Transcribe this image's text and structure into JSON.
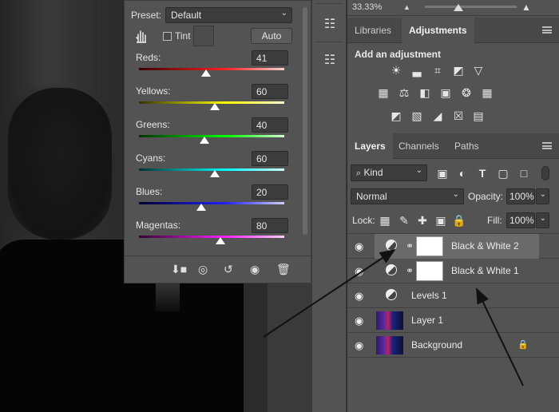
{
  "properties": {
    "preset_label": "Preset:",
    "preset_value": "Default",
    "tint_label": "Tint",
    "auto_label": "Auto",
    "sliders": [
      {
        "label": "Reds:",
        "value": "41"
      },
      {
        "label": "Yellows:",
        "value": "60"
      },
      {
        "label": "Greens:",
        "value": "40"
      },
      {
        "label": "Cyans:",
        "value": "60"
      },
      {
        "label": "Blues:",
        "value": "20"
      },
      {
        "label": "Magentas:",
        "value": "80"
      }
    ],
    "slider_fractions": [
      0.46,
      0.52,
      0.45,
      0.52,
      0.43,
      0.56
    ]
  },
  "top_bar": {
    "zoom": "33.33%"
  },
  "adjustments_panel": {
    "tabs": [
      "Libraries",
      "Adjustments"
    ],
    "active_tab": "Adjustments",
    "heading": "Add an adjustment",
    "icons_row1": [
      "brightness-icon",
      "levels-icon",
      "curves-icon",
      "exposure-icon",
      "vibrance-icon"
    ],
    "icons_row2": [
      "hue-saturation-icon",
      "color-balance-icon",
      "black-white-icon",
      "photo-filter-icon",
      "channel-mixer-icon",
      "color-lookup-icon"
    ],
    "icons_row3": [
      "invert-icon",
      "posterize-icon",
      "threshold-icon",
      "selective-color-icon",
      "gradient-map-icon"
    ]
  },
  "layers_panel": {
    "tabs": [
      "Layers",
      "Channels",
      "Paths"
    ],
    "active_tab": "Layers",
    "filter_value": "Kind",
    "blend_mode": "Normal",
    "opacity_label": "Opacity:",
    "opacity_value": "100%",
    "lock_label": "Lock:",
    "fill_label": "Fill:",
    "fill_value": "100%",
    "layers": [
      {
        "name": "Black & White 2",
        "kind": "adjustment-mask",
        "selected": true
      },
      {
        "name": "Black & White 1",
        "kind": "adjustment-mask",
        "selected": false
      },
      {
        "name": "Levels 1",
        "kind": "adjustment",
        "selected": false
      },
      {
        "name": "Layer 1",
        "kind": "image",
        "selected": false
      },
      {
        "name": "Background",
        "kind": "image-locked",
        "selected": false
      }
    ]
  }
}
